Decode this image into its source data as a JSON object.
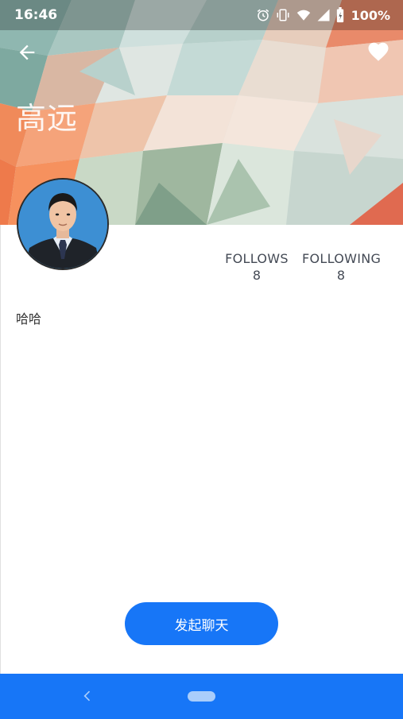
{
  "status_bar": {
    "time": "16:46",
    "battery": "100%",
    "icons": [
      "alarm-icon",
      "vibrate-icon",
      "wifi-icon",
      "signal-icon",
      "battery-icon"
    ]
  },
  "toolbar": {
    "back_icon": "arrow-back-icon",
    "favorite_icon": "heart-icon"
  },
  "profile": {
    "name": "高远",
    "bio": "哈哈"
  },
  "stats": [
    {
      "label": "FOLLOWS",
      "value": "8"
    },
    {
      "label": "FOLLOWING",
      "value": "8"
    }
  ],
  "actions": {
    "chat_label": "发起聊天"
  },
  "nav_bar": {
    "back_icon": "chevron-left-icon",
    "home_icon": "home-pill-icon"
  },
  "colors": {
    "accent": "#1776f7",
    "stat_text": "#444a55"
  }
}
